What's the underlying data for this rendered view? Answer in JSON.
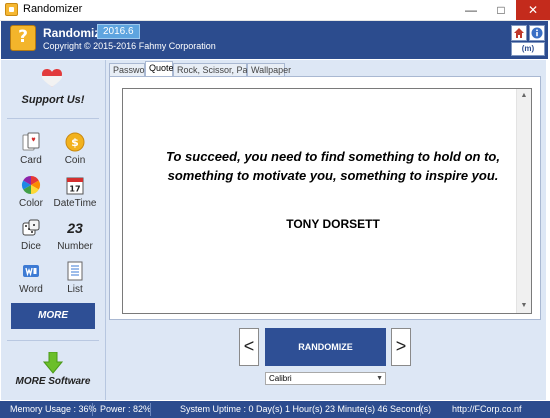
{
  "window": {
    "title": "Randomizer"
  },
  "header": {
    "app_name": "Randomizer",
    "version": "2016.6",
    "copyright": "Copyright © 2015-2016 Fahmy Corporation",
    "language_button": "(m)"
  },
  "sidebar": {
    "support_label": "Support Us!",
    "items": [
      {
        "label": "Card",
        "icon": "playing-card-icon"
      },
      {
        "label": "Coin",
        "icon": "coin-icon"
      },
      {
        "label": "Color",
        "icon": "color-wheel-icon"
      },
      {
        "label": "DateTime",
        "icon": "calendar-icon",
        "icon_text": "17"
      },
      {
        "label": "Dice",
        "icon": "dice-icon"
      },
      {
        "label": "Number",
        "icon": "number-icon",
        "icon_text": "23"
      },
      {
        "label": "Word",
        "icon": "word-icon"
      },
      {
        "label": "List",
        "icon": "list-icon"
      }
    ],
    "more_label": "MORE",
    "more_software_label": "MORE Software"
  },
  "tabs": [
    {
      "label": "Password",
      "active": false
    },
    {
      "label": "Quote",
      "active": true
    },
    {
      "label": "Rock, Scissor, Paper",
      "active": false
    },
    {
      "label": "Wallpaper",
      "active": false
    }
  ],
  "quote": {
    "text": "To succeed, you need to find something to hold on to, something to motivate you, something to inspire you.",
    "author": "TONY DORSETT"
  },
  "controls": {
    "prev": "<",
    "next": ">",
    "randomize_label": "RANDOMIZE",
    "font_value": "Calibri"
  },
  "status": {
    "memory": "Memory Usage : 36%",
    "power": "Power : 82%",
    "uptime": "System Uptime : 0 Day(s) 1 Hour(s) 23 Minute(s) 46 Second(s)",
    "url": "http://FCorp.co.nf"
  },
  "colors": {
    "accent": "#2c4c8e",
    "button": "#2e4f95",
    "sidebar_bg": "#dde7f5",
    "close": "#c42b1c"
  }
}
